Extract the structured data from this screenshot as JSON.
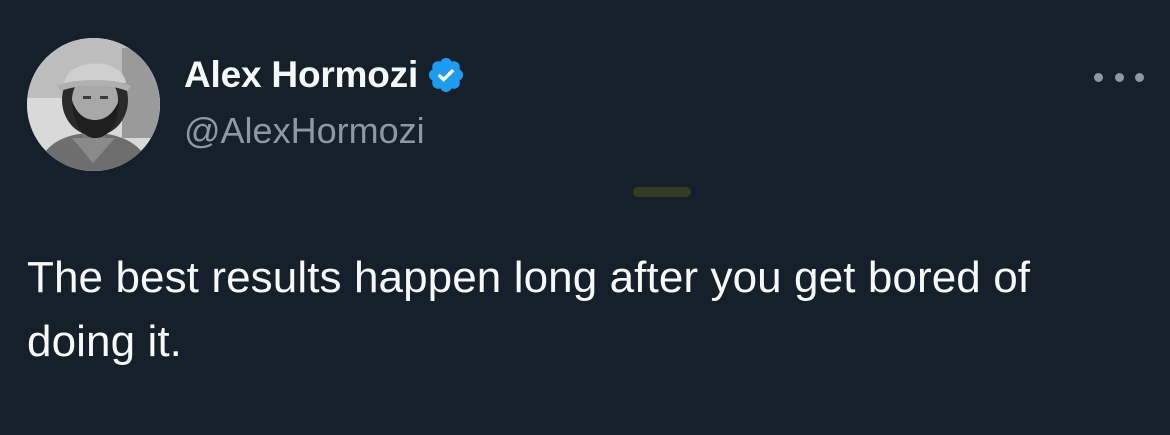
{
  "author": {
    "display_name": "Alex Hormozi",
    "handle": "@AlexHormozi",
    "verified": true,
    "avatar": "profile-photo"
  },
  "tweet": {
    "text": "The best results happen long after you get bored of doing it."
  },
  "icons": {
    "verified": "verified-badge-icon",
    "more": "more-options-icon"
  },
  "colors": {
    "background": "#15202b",
    "primary_text": "#f7f9f9",
    "secondary_text": "#8b98a5",
    "verified_blue": "#1d9bf0"
  }
}
